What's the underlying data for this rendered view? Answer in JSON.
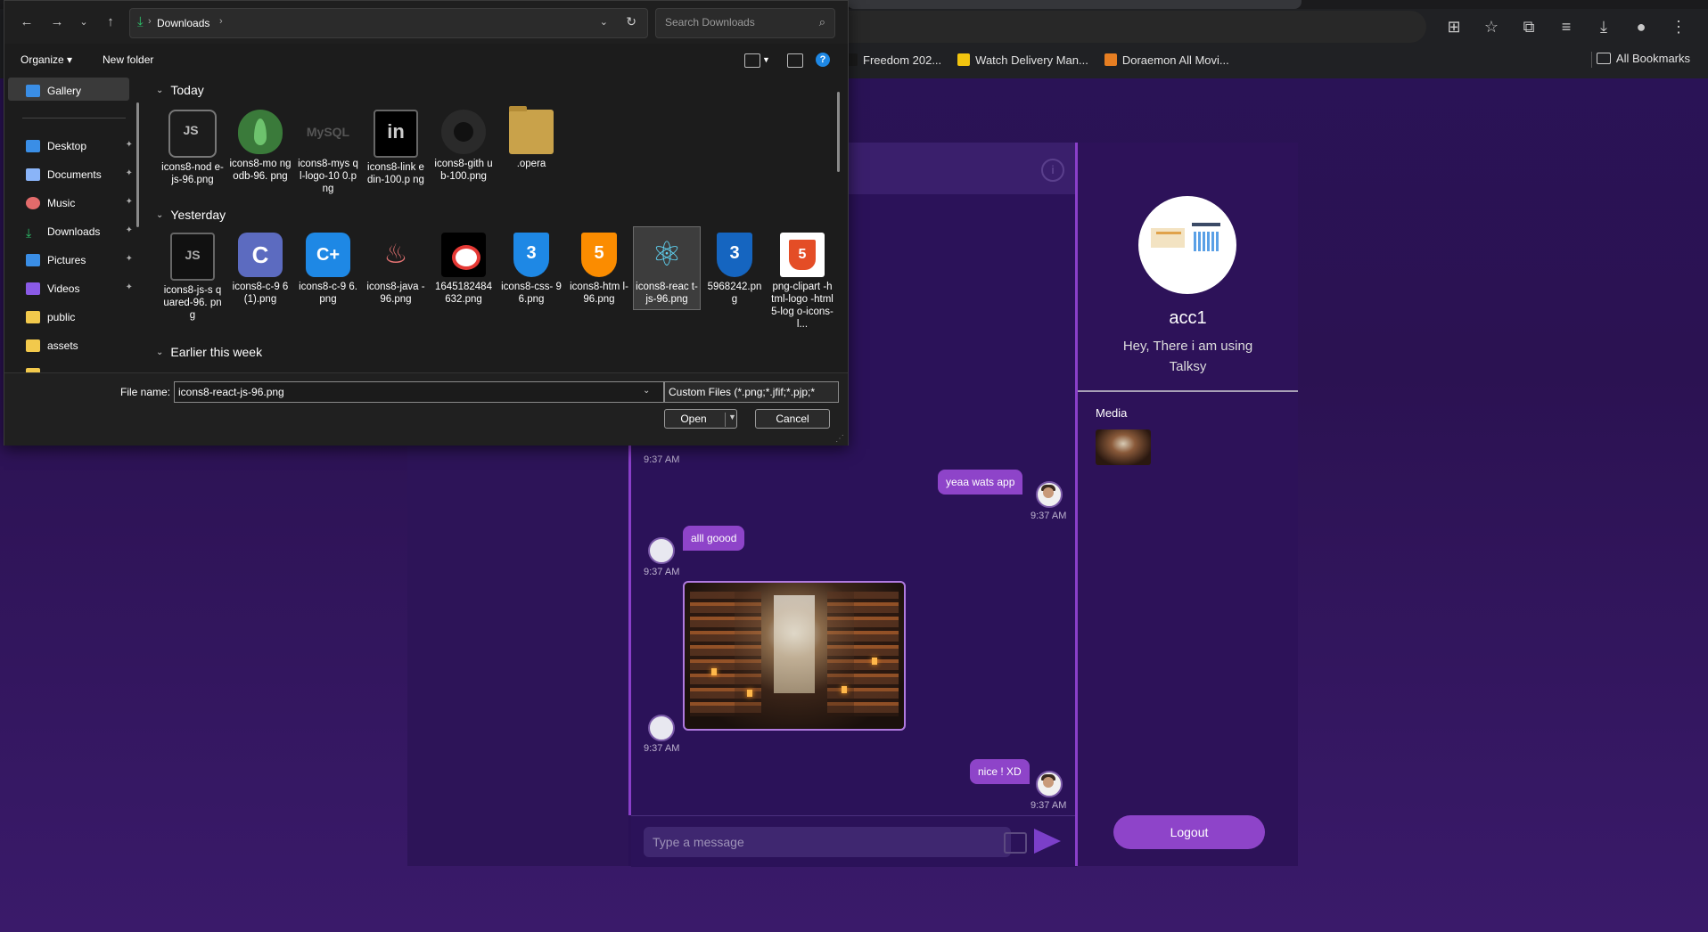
{
  "browser": {
    "bookmarks": [
      {
        "label": "Freedom 202...",
        "color": "#1a1a1a"
      },
      {
        "label": "Watch Delivery Man...",
        "color": "#f1c40f"
      },
      {
        "label": "Doraemon All Movi...",
        "color": "#e67e22"
      }
    ],
    "all_bookmarks": "All Bookmarks"
  },
  "dialog": {
    "path": "Downloads",
    "search_placeholder": "Search Downloads",
    "organize": "Organize",
    "new_folder": "New folder",
    "sidebar": [
      {
        "label": "Gallery",
        "icon": "gallery-icon",
        "color": "#3a8ee6"
      },
      {
        "label": "Desktop",
        "icon": "desktop-icon",
        "color": "#3a8ee6"
      },
      {
        "label": "Documents",
        "icon": "documents-icon",
        "color": "#8ab4f8"
      },
      {
        "label": "Music",
        "icon": "music-icon",
        "color": "#e36b6b"
      },
      {
        "label": "Downloads",
        "icon": "downloads-icon",
        "color": "#2dc26b"
      },
      {
        "label": "Pictures",
        "icon": "pictures-icon",
        "color": "#3a8ee6"
      },
      {
        "label": "Videos",
        "icon": "videos-icon",
        "color": "#8a5ae6"
      },
      {
        "label": "public",
        "icon": "folder-icon",
        "color": "#f2c94c"
      },
      {
        "label": "assets",
        "icon": "folder-icon",
        "color": "#f2c94c"
      }
    ],
    "groups": {
      "today": "Today",
      "yesterday": "Yesterday",
      "earlier": "Earlier this week"
    },
    "files_today": [
      {
        "name": "icons8-nod e-js-96.png",
        "icon": "nodejs-icon"
      },
      {
        "name": "icons8-mo ngodb-96. png",
        "icon": "mongodb-icon"
      },
      {
        "name": "icons8-mys ql-logo-10 0.png",
        "icon": "mysql-icon"
      },
      {
        "name": "icons8-link edin-100.p ng",
        "icon": "linkedin-icon"
      },
      {
        "name": "icons8-gith ub-100.png",
        "icon": "github-icon"
      },
      {
        "name": ".opera",
        "icon": "folder-icon"
      }
    ],
    "files_yesterday": [
      {
        "name": "icons8-js-s quared-96. png",
        "icon": "js-icon"
      },
      {
        "name": "icons8-c-9 6 (1).png",
        "icon": "c-icon"
      },
      {
        "name": "icons8-c-9 6.png",
        "icon": "cpp-icon"
      },
      {
        "name": "icons8-java -96.png",
        "icon": "java-icon"
      },
      {
        "name": "1645182484 632.png",
        "icon": "image-icon"
      },
      {
        "name": "icons8-css- 96.png",
        "icon": "css-icon"
      },
      {
        "name": "icons8-htm l-96.png",
        "icon": "html-icon"
      },
      {
        "name": "icons8-reac t-js-96.png",
        "icon": "react-icon"
      },
      {
        "name": "5968242.pn g",
        "icon": "css-icon"
      },
      {
        "name": "png-clipart -html-logo -html5-log o-icons-l...",
        "icon": "html-icon"
      }
    ],
    "file_name_label": "File name:",
    "file_name_value": "icons8-react-js-96.png",
    "filter": "Custom Files (*.png;*.jfif;*.pjp;*",
    "open": "Open",
    "cancel": "Cancel"
  },
  "chat": {
    "messages": [
      {
        "side": "left",
        "time": "9:37 AM"
      },
      {
        "side": "right",
        "text": "yeaa wats app",
        "time": "9:37 AM"
      },
      {
        "side": "left",
        "text": "alll goood",
        "time": "9:37 AM"
      },
      {
        "side": "left",
        "image": "library-photo",
        "time": "9:37 AM"
      },
      {
        "side": "right",
        "text": "nice ! XD",
        "time": "9:37 AM"
      }
    ],
    "input_placeholder": "Type a message"
  },
  "profile": {
    "name": "acc1",
    "status": "Hey, There i am using Talksy",
    "media_label": "Media",
    "logout": "Logout"
  },
  "colors": {
    "accent": "#8e44c9",
    "background": "#2b1259"
  }
}
